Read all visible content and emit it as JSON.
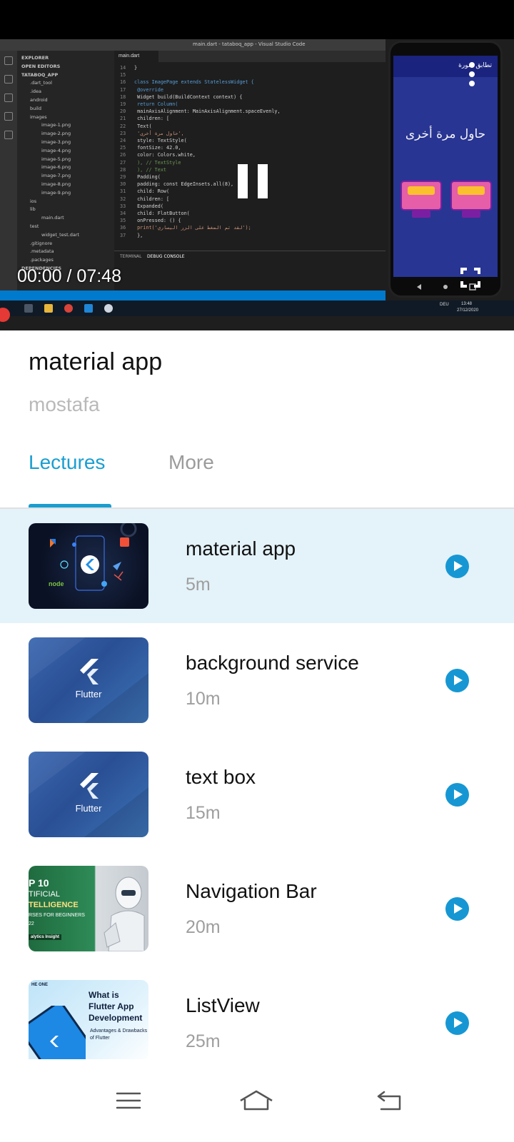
{
  "video": {
    "current_time": "00:00",
    "separator": "/",
    "duration": "07:48",
    "vs_title": "main.dart - tataboq_app - Visual Studio Code",
    "vs_tab": "main.dart",
    "phone_appbar_title": "تطابق صورة",
    "phone_text": "حاول مرة أخرى",
    "code_lines": [
      {
        "n": "14",
        "t": "}"
      },
      {
        "n": "15",
        "t": ""
      },
      {
        "n": "16",
        "t": "class ImagePage extends StatelessWidget {"
      },
      {
        "n": "17",
        "t": "  @override"
      },
      {
        "n": "18",
        "t": "  Widget build(BuildContext context) {"
      },
      {
        "n": "19",
        "t": "    return Column("
      },
      {
        "n": "20",
        "t": "      mainAxisAlignment: MainAxisAlignment.spaceEvenly,"
      },
      {
        "n": "21",
        "t": "      children: ["
      },
      {
        "n": "22",
        "t": "        Text("
      },
      {
        "n": "23",
        "t": "          'حاول مرة أخرى',"
      },
      {
        "n": "24",
        "t": "          style: TextStyle("
      },
      {
        "n": "25",
        "t": "            fontSize: 42.0,"
      },
      {
        "n": "26",
        "t": "            color: Colors.white,"
      },
      {
        "n": "27",
        "t": "          ), // TextStyle"
      },
      {
        "n": "28",
        "t": "        ), // Text"
      },
      {
        "n": "29",
        "t": "        Padding("
      },
      {
        "n": "30",
        "t": "          padding: const EdgeInsets.all(8),"
      },
      {
        "n": "31",
        "t": "          child: Row("
      },
      {
        "n": "32",
        "t": "            children: ["
      },
      {
        "n": "33",
        "t": "              Expanded("
      },
      {
        "n": "34",
        "t": "                child: FlatButton("
      },
      {
        "n": "35",
        "t": "                  onPressed: () {"
      },
      {
        "n": "36",
        "t": "                    print('لقد تم الضغط على الزر اليساري');"
      },
      {
        "n": "37",
        "t": "                  },"
      }
    ],
    "explorer_items": [
      "EXPLORER",
      "OPEN EDITORS",
      "TATABOQ_APP",
      ".dart_tool",
      ".idea",
      "android",
      "build",
      "images",
      "image-1.png",
      "image-2.png",
      "image-3.png",
      "image-4.png",
      "image-5.png",
      "image-6.png",
      "image-7.png",
      "image-8.png",
      "image-9.png",
      "ios",
      "lib",
      "main.dart",
      "test",
      "widget_test.dart",
      ".gitignore",
      ".metadata",
      ".packages",
      "DEPENDENCIES"
    ],
    "panel_tabs": [
      "TERMINAL",
      "DEBUG CONSOLE"
    ],
    "taskbar_clock": "13:48",
    "taskbar_date": "27/12/2020",
    "taskbar_lang": "DEU"
  },
  "course": {
    "title": "material app",
    "author": "mostafa"
  },
  "tabs": [
    {
      "label": "Lectures",
      "active": true
    },
    {
      "label": "More",
      "active": false
    }
  ],
  "lectures": [
    {
      "title": "material app",
      "duration": "5m",
      "active": true,
      "thumb": "tech-logos"
    },
    {
      "title": "background service",
      "duration": "10m",
      "active": false,
      "thumb": "flutter"
    },
    {
      "title": "text box",
      "duration": "15m",
      "active": false,
      "thumb": "flutter"
    },
    {
      "title": "Navigation Bar",
      "duration": "20m",
      "active": false,
      "thumb": "ai-courses"
    },
    {
      "title": "ListView",
      "duration": "25m",
      "active": false,
      "thumb": "flutter-app-dev"
    }
  ],
  "thumb_text": {
    "flutter_word": "Flutter",
    "node_word": "node",
    "ai_lines": [
      "P 10",
      "TIFICIAL",
      "TELLIGENCE",
      "RSES FOR BEGINNERS",
      "22",
      "alytics Insight"
    ],
    "app_lines": [
      "What is",
      "Flutter App",
      "Development",
      "Advantages & Drawbacks",
      "of Flutter",
      "HE ONE"
    ]
  },
  "icons": {
    "pause": "pause-icon",
    "menu": "kebab-menu-icon",
    "fullscreen": "fullscreen-icon",
    "play": "play-circle-icon",
    "nav_menu": "hamburger-icon",
    "nav_home": "home-icon",
    "nav_back": "back-icon"
  },
  "colors": {
    "accent": "#1a9ed0",
    "active_row": "#e4f2f9",
    "play_button": "#1697d3"
  }
}
